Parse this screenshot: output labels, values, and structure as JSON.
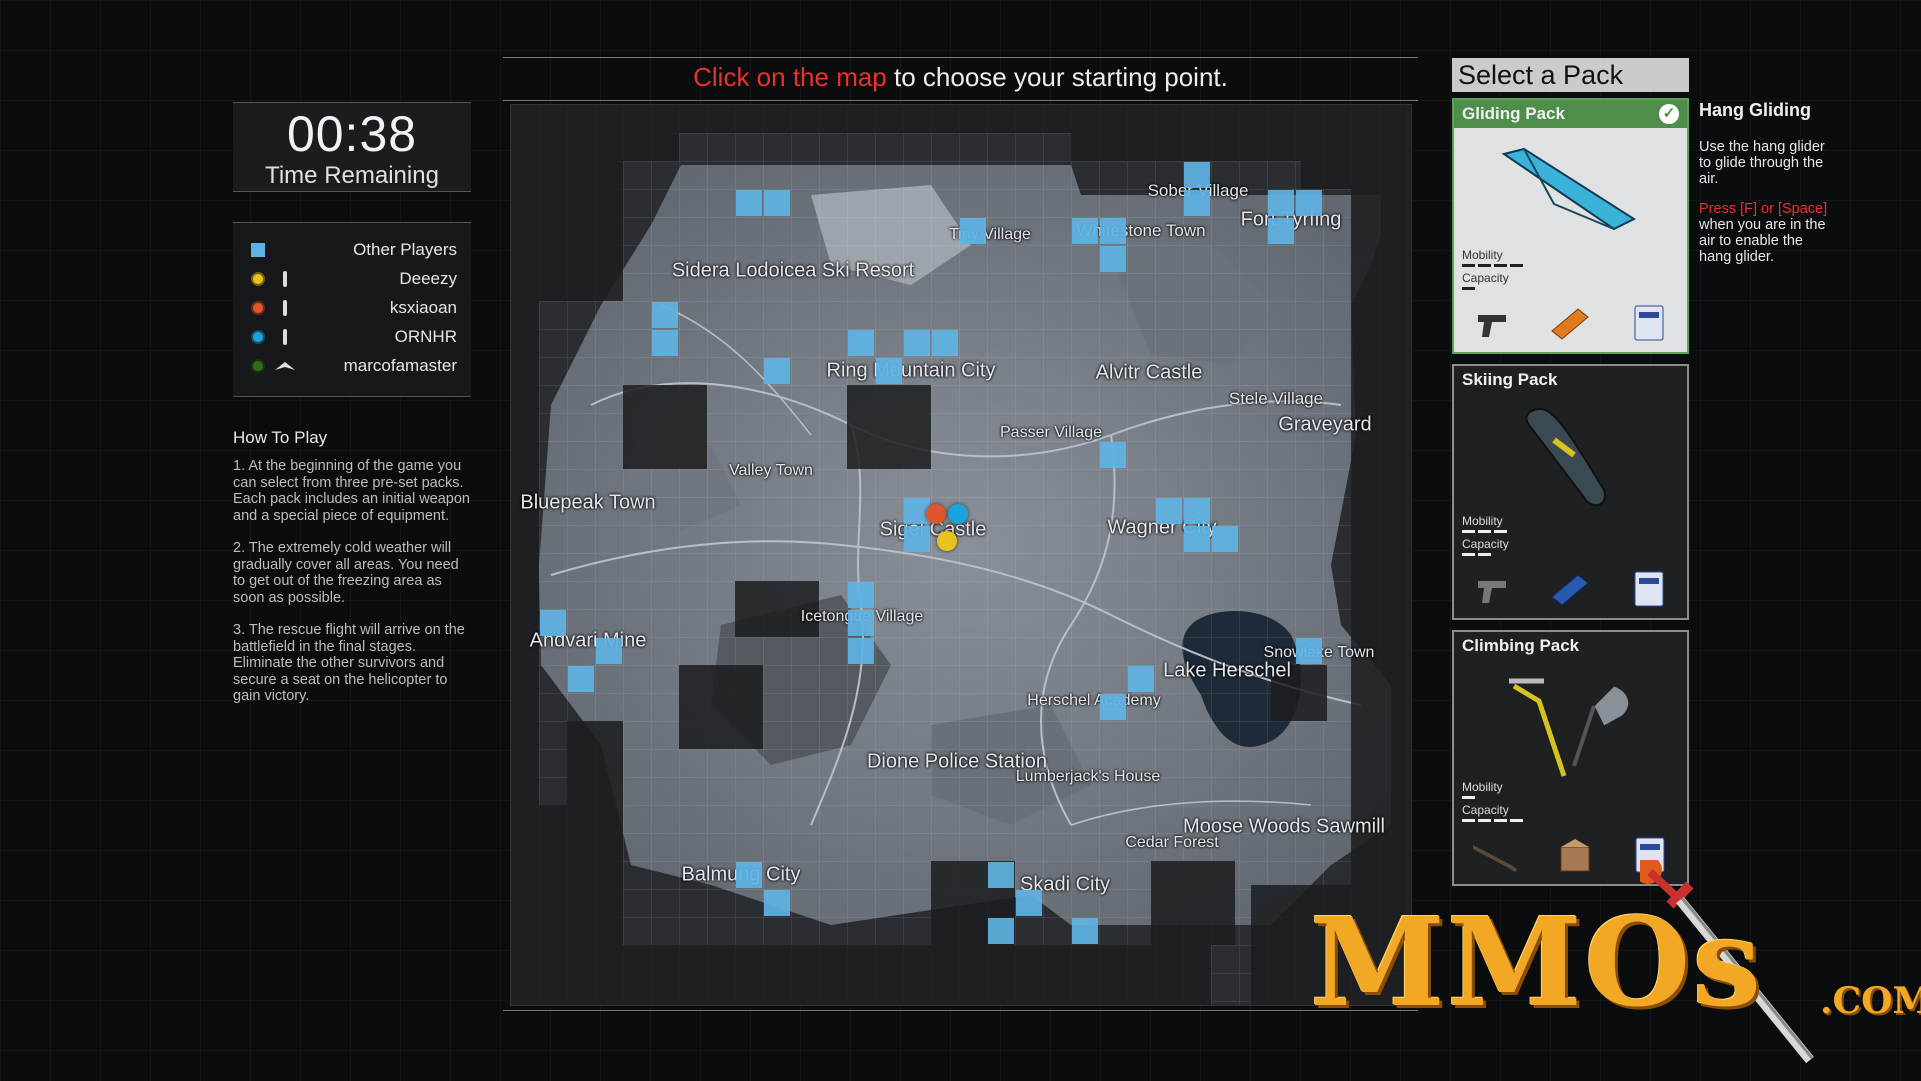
{
  "timer": {
    "time": "00:38",
    "label": "Time Remaining"
  },
  "legend": [
    {
      "type": "square",
      "color": "#5fb3e4",
      "name": "Other Players"
    },
    {
      "type": "dot",
      "color": "#e8c21e",
      "marker": "bar",
      "name": "Deeezy"
    },
    {
      "type": "dot",
      "color": "#e0552d",
      "marker": "bar",
      "name": "ksxiaoan"
    },
    {
      "type": "dot",
      "color": "#19a4dc",
      "marker": "bar",
      "name": "ORNHR"
    },
    {
      "type": "dot",
      "color": "#2f6a1d",
      "marker": "glider",
      "name": "marcofamaster"
    }
  ],
  "howto": {
    "title": "How To Play",
    "steps": [
      "1. At the beginning of the game you can select from three pre-set packs. Each pack includes an initial weapon and a special piece of equipment.",
      "2. The extremely cold weather will gradually cover all areas. You need to get out of the freezing area as soon as possible.",
      "3. The rescue flight will arrive on the battlefield in the final stages. Eliminate the other survivors and secure a seat on the helicopter to gain victory."
    ]
  },
  "instruction": {
    "highlight": "Click on the map",
    "rest": " to choose your starting point."
  },
  "map": {
    "towns": [
      {
        "name": "Sober Village",
        "size": 17
      },
      {
        "name": "Fort Tyrfing",
        "size": 20
      },
      {
        "name": "Tiny Village",
        "size": 16
      },
      {
        "name": "Whitestone Town",
        "size": 17
      },
      {
        "name": "Sidera Lodoicea Ski Resort",
        "size": 20
      },
      {
        "name": "Ring Mountain City",
        "size": 20
      },
      {
        "name": "Alvitr Castle",
        "size": 20
      },
      {
        "name": "Stele Village",
        "size": 17
      },
      {
        "name": "Graveyard",
        "size": 20
      },
      {
        "name": "Passer Village",
        "size": 16
      },
      {
        "name": "Valley Town",
        "size": 16
      },
      {
        "name": "Bluepeak Town",
        "size": 20
      },
      {
        "name": "Sigel Castle",
        "size": 20
      },
      {
        "name": "Wagner City",
        "size": 20
      },
      {
        "name": "Icetongue Village",
        "size": 16
      },
      {
        "name": "Andvari Mine",
        "size": 20
      },
      {
        "name": "Snowlake Town",
        "size": 16
      },
      {
        "name": "Lake Herschel",
        "size": 20
      },
      {
        "name": "Herschel Academy",
        "size": 16
      },
      {
        "name": "Dione Police Station",
        "size": 20
      },
      {
        "name": "Lumberjack's House",
        "size": 16
      },
      {
        "name": "Moose Woods Sawmill",
        "size": 20
      },
      {
        "name": "Cedar Forest",
        "size": 16
      },
      {
        "name": "Balmung City",
        "size": 20
      },
      {
        "name": "Skadi City",
        "size": 20
      }
    ]
  },
  "packs": {
    "title": "Select a Pack",
    "items": [
      {
        "name": "Gliding Pack",
        "selected": true,
        "mobility_label": "Mobility",
        "capacity_label": "Capacity",
        "mobility": 4,
        "capacity": 1,
        "items": [
          "pistol-icon",
          "ammo-box-icon",
          "supply-bag-icon"
        ]
      },
      {
        "name": "Skiing Pack",
        "selected": false,
        "mobility_label": "Mobility",
        "capacity_label": "Capacity",
        "mobility": 3,
        "capacity": 2,
        "items": [
          "pistol-icon",
          "ammo-box-icon",
          "supply-bag-icon"
        ]
      },
      {
        "name": "Climbing Pack",
        "selected": false,
        "mobility_label": "Mobility",
        "capacity_label": "Capacity",
        "mobility": 1,
        "capacity": 4,
        "items": [
          "rifle-icon",
          "crate-icon",
          "supply-bag-icon"
        ]
      }
    ]
  },
  "description": {
    "title": "Hang Gliding",
    "text": "Use the hang glider to glide through the air.",
    "hint_highlight": "Press [F] or [Space]",
    "hint_rest": " when you are in the air to enable the hang glider."
  },
  "watermark": {
    "text": "MMOs",
    "suffix": ".COM"
  },
  "colors": {
    "accent_red": "#e8322c",
    "other_player_blue": "#5fb3e4",
    "selected_green": "#4e8e4a"
  }
}
